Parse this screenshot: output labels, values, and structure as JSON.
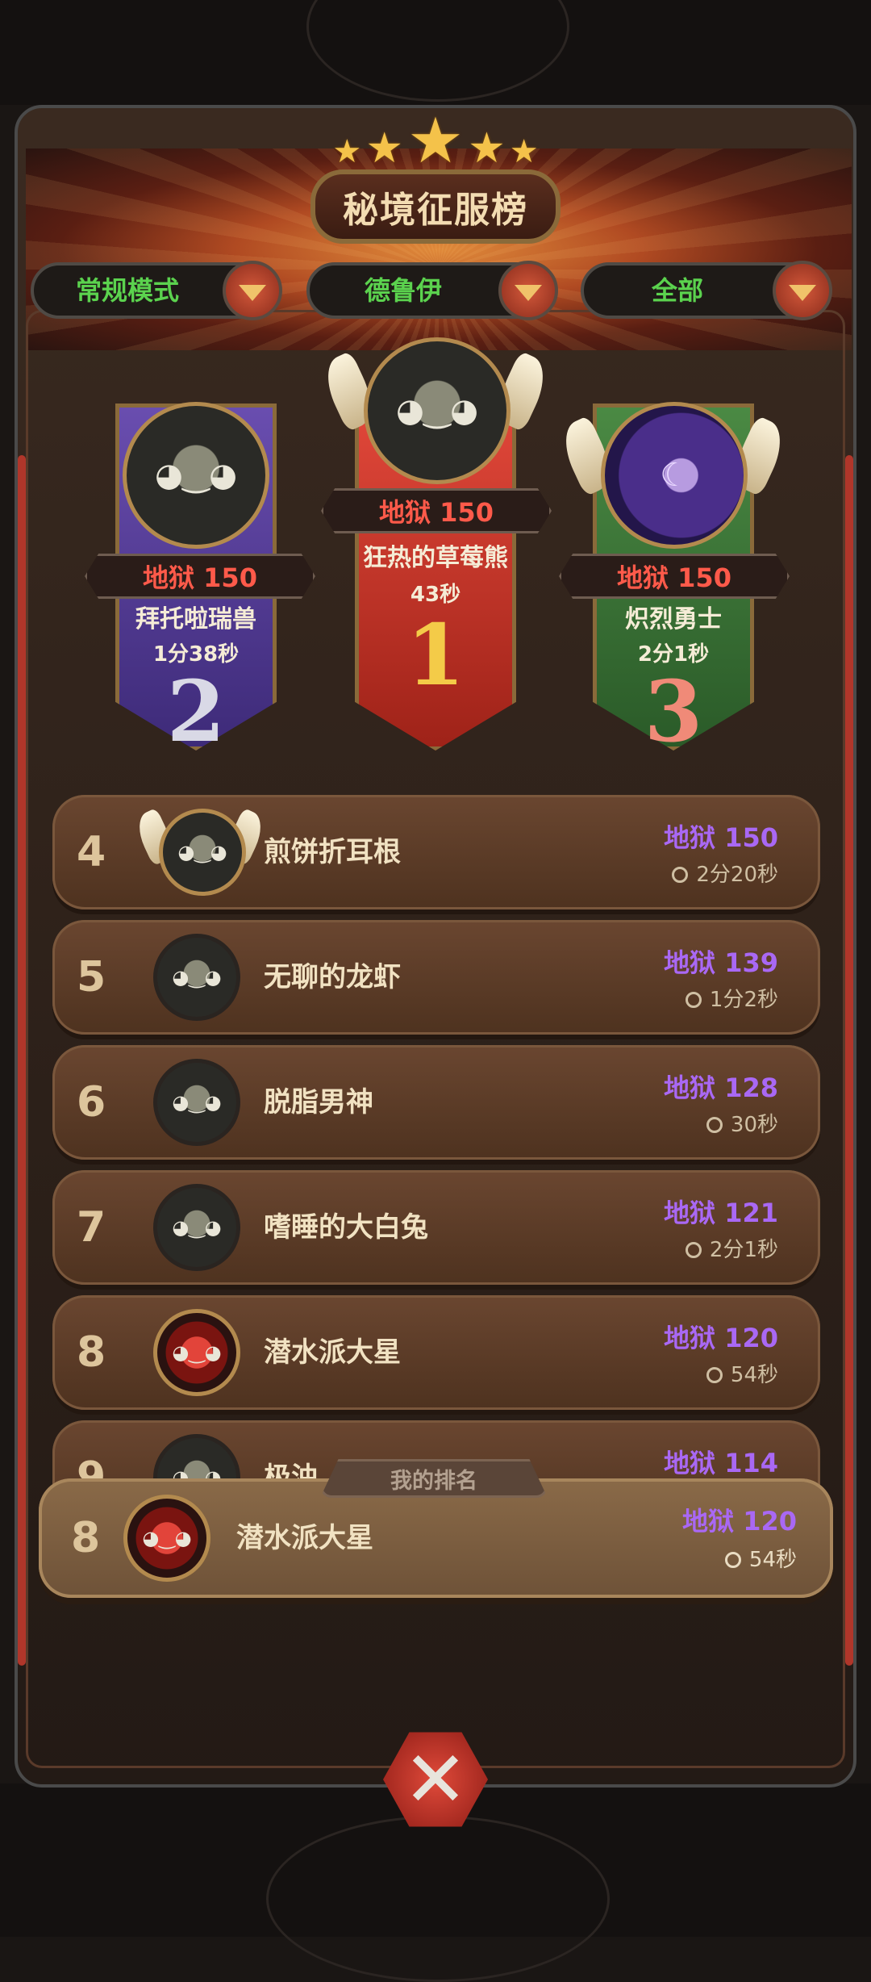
{
  "title": "秘境征服榜",
  "stars": 5,
  "filters": [
    {
      "label": "常规模式"
    },
    {
      "label": "德鲁伊"
    },
    {
      "label": "全部"
    }
  ],
  "podium": {
    "first": {
      "rank": "1",
      "difficulty": "地狱 150",
      "name": "狂热的草莓熊",
      "time": "43秒"
    },
    "second": {
      "rank": "2",
      "difficulty": "地狱 150",
      "name": "拜托啦瑞兽",
      "time": "1分38秒"
    },
    "third": {
      "rank": "3",
      "difficulty": "地狱 150",
      "name": "炽烈勇士",
      "time": "2分1秒"
    }
  },
  "rows": [
    {
      "rank": "4",
      "name": "煎饼折耳根",
      "difficulty": "地狱 150",
      "time": "2分20秒"
    },
    {
      "rank": "5",
      "name": "无聊的龙虾",
      "difficulty": "地狱 139",
      "time": "1分2秒"
    },
    {
      "rank": "6",
      "name": "脱脂男神",
      "difficulty": "地狱 128",
      "time": "30秒"
    },
    {
      "rank": "7",
      "name": "嗜睡的大白兔",
      "difficulty": "地狱 121",
      "time": "2分1秒"
    },
    {
      "rank": "8",
      "name": "潜水派大星",
      "difficulty": "地狱 120",
      "time": "54秒"
    },
    {
      "rank": "9",
      "name": "极浊",
      "difficulty": "地狱 114",
      "time": ""
    }
  ],
  "my_rank": {
    "tag": "我的排名",
    "rank": "8",
    "name": "潜水派大星",
    "difficulty": "地狱 120",
    "time": "54秒"
  },
  "colors": {
    "difficulty_red": "#ff5a4a",
    "difficulty_purple": "#a968f4",
    "filter_green": "#5bd24e",
    "second_banner": "#5a3f9a",
    "first_banner": "#c0352a",
    "third_banner": "#3e7a3a"
  },
  "icons": {
    "close": "close-icon",
    "dropdown": "chevron-down-icon",
    "clock": "clock-icon"
  }
}
